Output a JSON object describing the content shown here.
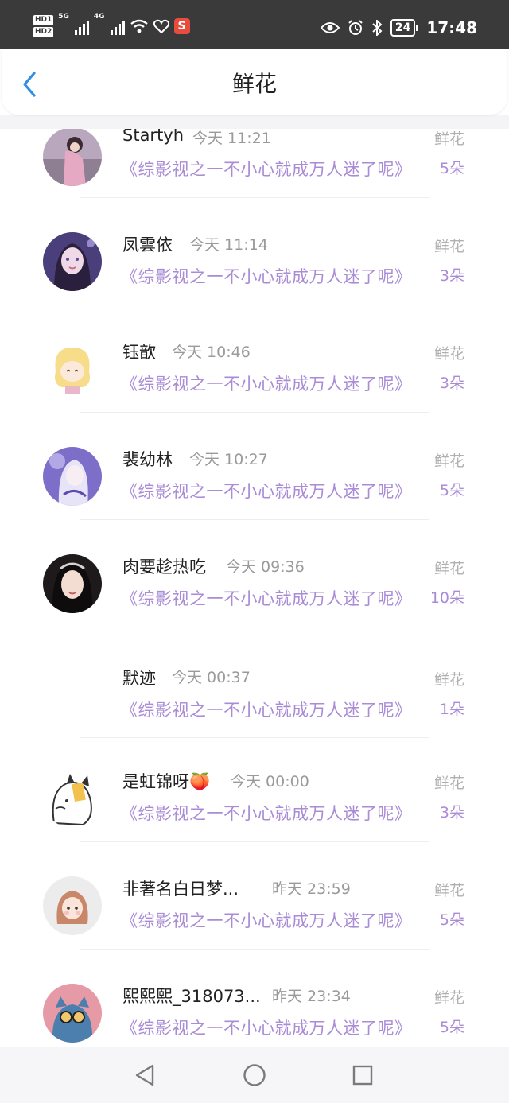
{
  "status_bar": {
    "hd1": "HD1",
    "hd2": "HD2",
    "net1": "5G",
    "net2": "4G",
    "app_badge": "S",
    "battery": "24",
    "time": "17:48"
  },
  "header": {
    "title": "鲜花"
  },
  "items": [
    {
      "name": "Startyh",
      "time": "今天 11:21",
      "book": "《综影视之一不小心就成万人迷了呢》",
      "gift_label": "鲜花",
      "count": "5朵"
    },
    {
      "name": "凤雲依",
      "time": "今天 11:14",
      "book": "《综影视之一不小心就成万人迷了呢》",
      "gift_label": "鲜花",
      "count": "3朵"
    },
    {
      "name": "钰歆",
      "time": "今天 10:46",
      "book": "《综影视之一不小心就成万人迷了呢》",
      "gift_label": "鲜花",
      "count": "3朵"
    },
    {
      "name": "裴幼林",
      "time": "今天 10:27",
      "book": "《综影视之一不小心就成万人迷了呢》",
      "gift_label": "鲜花",
      "count": "5朵"
    },
    {
      "name": "肉要趁热吃",
      "time": "今天 09:36",
      "book": "《综影视之一不小心就成万人迷了呢》",
      "gift_label": "鲜花",
      "count": "10朵"
    },
    {
      "name": "默迹",
      "time": "今天 00:37",
      "book": "《综影视之一不小心就成万人迷了呢》",
      "gift_label": "鲜花",
      "count": "1朵"
    },
    {
      "name": "是虹锦呀🍑",
      "time": "今天 00:00",
      "book": "《综影视之一不小心就成万人迷了呢》",
      "gift_label": "鲜花",
      "count": "3朵"
    },
    {
      "name": "非著名白日梦...",
      "time": "昨天 23:59",
      "book": "《综影视之一不小心就成万人迷了呢》",
      "gift_label": "鲜花",
      "count": "5朵"
    },
    {
      "name": "熙熙熙_318073...",
      "time": "昨天 23:34",
      "book": "《综影视之一不小心就成万人迷了呢》",
      "gift_label": "鲜花",
      "count": "5朵"
    }
  ],
  "colors": {
    "accent_purple": "#a98bd6",
    "back_blue": "#2f8fe6",
    "status_bg": "#3a3a3a"
  },
  "icons": {
    "back": "chevron-left-icon",
    "nav_back": "triangle-back-icon",
    "nav_home": "circle-home-icon",
    "nav_recent": "square-recent-icon"
  }
}
